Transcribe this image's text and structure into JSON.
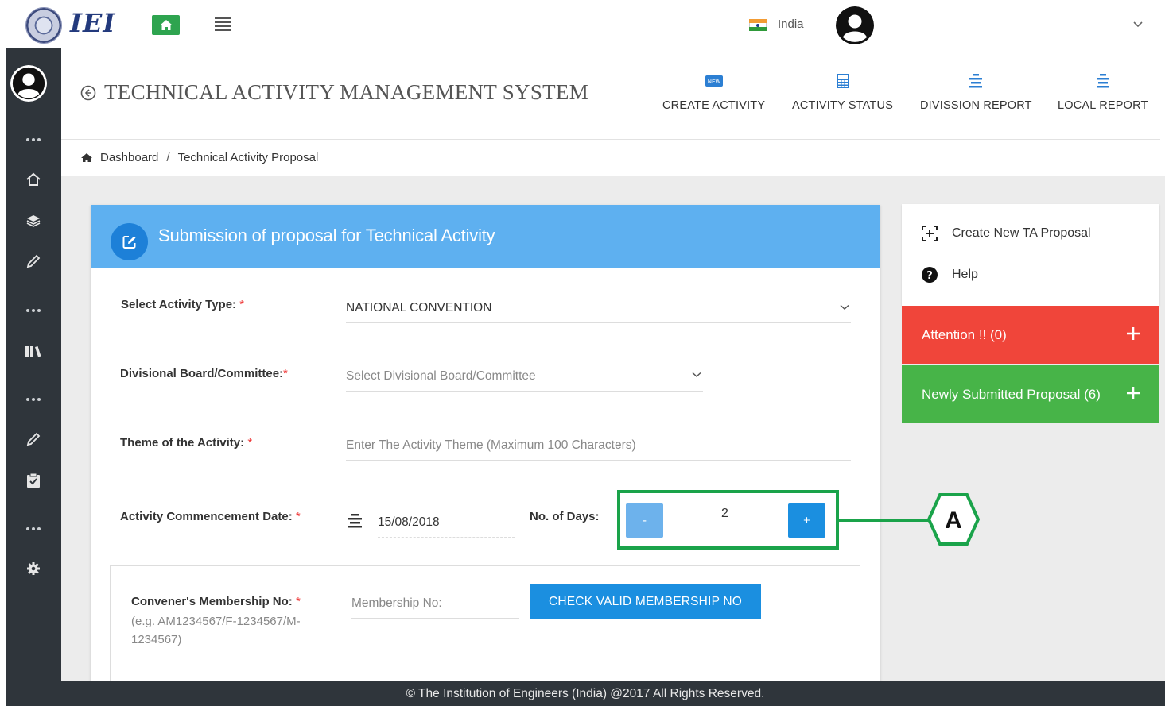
{
  "app": {
    "logo_text": "IEI",
    "country": "India"
  },
  "header": {
    "system_title": "TECHNICAL ACTIVITY MANAGEMENT SYSTEM",
    "nav": [
      {
        "label": "CREATE ACTIVITY",
        "icon": "new-badge-icon"
      },
      {
        "label": "ACTIVITY STATUS",
        "icon": "calculator-icon"
      },
      {
        "label": "DIVISSION REPORT",
        "icon": "list-icon"
      },
      {
        "label": "LOCAL REPORT",
        "icon": "list-icon"
      }
    ]
  },
  "breadcrumb": {
    "home": "Dashboard",
    "separator": "/",
    "current": "Technical Activity Proposal"
  },
  "form": {
    "title": "Submission of proposal for Technical Activity",
    "activity_type": {
      "label": "Select Activity Type:",
      "required": "*",
      "value": "NATIONAL CONVENTION"
    },
    "divisional_board": {
      "label": "Divisional Board/Committee:",
      "required": "*",
      "placeholder": "Select Divisional Board/Committee"
    },
    "theme": {
      "label": "Theme of the Activity:",
      "required": "*",
      "placeholder": "Enter The Activity Theme (Maximum 100 Characters)"
    },
    "commencement": {
      "label": "Activity Commencement Date:",
      "required": "*",
      "value": "15/08/2018"
    },
    "days": {
      "label": "No. of Days:",
      "minus": "-",
      "value": "2",
      "plus": "+"
    },
    "membership": {
      "label": "Convener's Membership No:",
      "required": "*",
      "hint": "(e.g. AM1234567/F-1234567/M-1234567)",
      "placeholder": "Membership No:",
      "check_button": "CHECK VALID MEMBERSHIP NO"
    }
  },
  "callout": {
    "letter": "A",
    "color": "#1aa34a"
  },
  "right_panel": {
    "create_new": "Create New TA Proposal",
    "help": "Help",
    "attention": "Attention !! (0)",
    "newly_submitted": "Newly Submitted Proposal (6)"
  },
  "colors": {
    "header_blue": "#5eb0f0",
    "button_blue": "#1b8fe0",
    "attention_red": "#f0453a",
    "submitted_green": "#47b448",
    "sidebar_dark": "#2f353b"
  },
  "footer": {
    "text": "© The Institution of Engineers (India) @2017 All Rights Reserved."
  }
}
